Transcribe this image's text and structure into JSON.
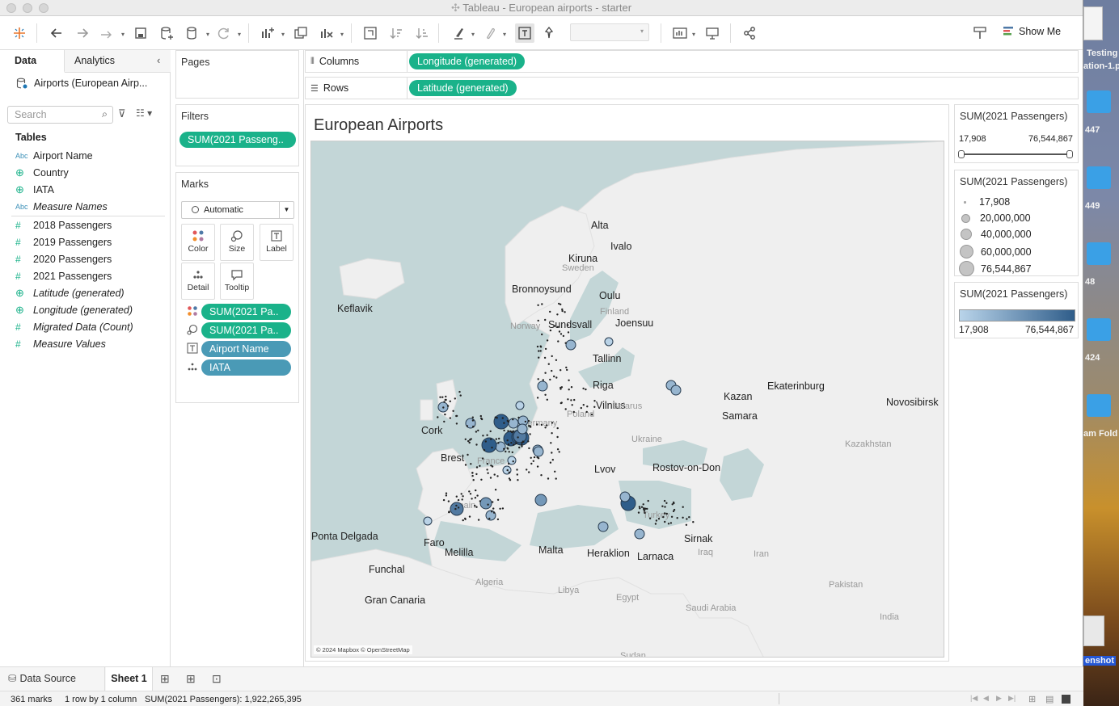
{
  "window": {
    "title": "Tableau - European airports - starter"
  },
  "toolbar": {
    "show_me": "Show Me"
  },
  "data_pane": {
    "tabs": [
      "Data",
      "Analytics"
    ],
    "datasource": "Airports (European Airp...",
    "search_placeholder": "Search",
    "tables_heading": "Tables",
    "fields": [
      {
        "icon": "Abc",
        "name": "Airport Name",
        "italic": false
      },
      {
        "icon": "globe",
        "name": "Country",
        "italic": false
      },
      {
        "icon": "globe",
        "name": "IATA",
        "italic": false
      },
      {
        "icon": "Abc",
        "name": "Measure Names",
        "italic": true
      },
      {
        "icon": "#",
        "name": "2018 Passengers",
        "italic": false
      },
      {
        "icon": "#",
        "name": "2019 Passengers",
        "italic": false
      },
      {
        "icon": "#",
        "name": "2020 Passengers",
        "italic": false
      },
      {
        "icon": "#",
        "name": "2021 Passengers",
        "italic": false
      },
      {
        "icon": "globe",
        "name": "Latitude (generated)",
        "italic": true
      },
      {
        "icon": "globe",
        "name": "Longitude (generated)",
        "italic": true
      },
      {
        "icon": "#",
        "name": "Migrated Data (Count)",
        "italic": true
      },
      {
        "icon": "#",
        "name": "Measure Values",
        "italic": true
      }
    ]
  },
  "cards": {
    "pages": "Pages",
    "filters": "Filters",
    "filter_pill": "SUM(2021 Passeng..",
    "marks": "Marks",
    "mark_type": "Automatic",
    "mark_buttons": [
      "Color",
      "Size",
      "Label",
      "Detail",
      "Tooltip"
    ],
    "mark_pills": [
      "SUM(2021 Pa..",
      "SUM(2021 Pa..",
      "Airport Name",
      "IATA"
    ]
  },
  "shelves": {
    "columns_label": "Columns",
    "columns_pill": "Longitude (generated)",
    "rows_label": "Rows",
    "rows_pill": "Latitude (generated)"
  },
  "view": {
    "title": "European Airports",
    "attribution": "© 2024 Mapbox © OpenStreetMap",
    "city_labels": [
      "Alta",
      "Ivalo",
      "Kiruna",
      "Keflavik",
      "Bronnoysund",
      "Oulu",
      "Sundsvall",
      "Joensuu",
      "Tallinn",
      "Riga",
      "Vilnius",
      "Cork",
      "Brest",
      "Lvov",
      "Rostov-on-Don",
      "Kazan",
      "Samara",
      "Ekaterinburg",
      "Novosibirsk",
      "Ponta Delgada",
      "Faro",
      "Melilla",
      "Malta",
      "Heraklion",
      "Larnaca",
      "Sirnak",
      "Funchal",
      "Gran Canaria"
    ],
    "region_labels": [
      "Sweden",
      "Finland",
      "Norway",
      "Poland",
      "Belarus",
      "Ukraine",
      "France",
      "Germany",
      "Spain",
      "Turkey",
      "Kazakhstan",
      "Algeria",
      "Libya",
      "Egypt",
      "Iraq",
      "Iran",
      "Saudi Arabia",
      "Pakistan",
      "India",
      "Sudan"
    ]
  },
  "legends": {
    "filter": {
      "title": "SUM(2021 Passengers)",
      "min": "17,908",
      "max": "76,544,867"
    },
    "size": {
      "title": "SUM(2021 Passengers)",
      "items": [
        "17,908",
        "20,000,000",
        "40,000,000",
        "60,000,000",
        "76,544,867"
      ]
    },
    "color": {
      "title": "SUM(2021 Passengers)",
      "min": "17,908",
      "max": "76,544,867",
      "color_low": "#b9d4ea",
      "color_high": "#2f5d8a"
    }
  },
  "sheet_tabs": {
    "data_source": "Data Source",
    "sheet": "Sheet 1"
  },
  "status": {
    "marks": "361 marks",
    "layout": "1 row by 1 column",
    "sum": "SUM(2021 Passengers): 1,922,265,395"
  },
  "desktop": {
    "labels": [
      "Testing",
      "ation-1.p",
      "447",
      "449",
      "48",
      "424",
      "am Fold",
      "enshot"
    ]
  }
}
